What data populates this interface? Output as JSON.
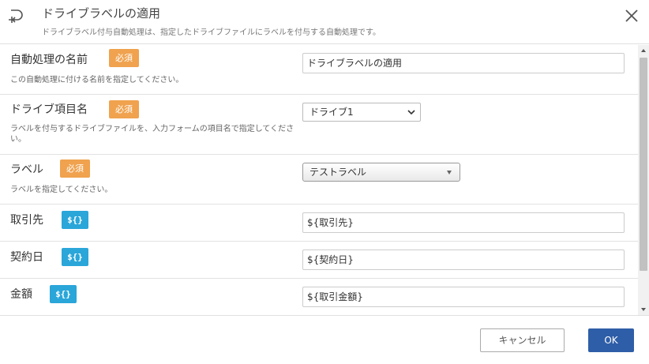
{
  "header": {
    "title": "ドライブラベルの適用",
    "subtitle": "ドライブラベル付与自動処理は、指定したドライブファイルにラベルを付与する自動処理です。",
    "icon": "add-process-icon"
  },
  "badges": {
    "required": "必須",
    "variable": "${}"
  },
  "fields": [
    {
      "label": "自動処理の名前",
      "required": true,
      "description": "この自動処理に付ける名前を指定してください。",
      "value": "ドライブラベルの適用"
    },
    {
      "label": "ドライブ項目名",
      "required": true,
      "description": "ラベルを付与するドライブファイルを、入力フォームの項目名で指定してください。",
      "selected": "ドライブ1"
    },
    {
      "label": "ラベル",
      "required": true,
      "description": "ラベルを指定してください。",
      "selected": "テストラベル"
    },
    {
      "label": "取引先",
      "variable": true,
      "value": "${取引先}"
    },
    {
      "label": "契約日",
      "variable": true,
      "value": "${契約日}"
    },
    {
      "label": "金額",
      "variable": true,
      "value": "${取引金額}"
    }
  ],
  "footer": {
    "cancel_label": "キャンセル",
    "ok_label": "OK"
  },
  "colors": {
    "required_badge": "#f0a24e",
    "variable_badge": "#2aa6d9",
    "ok_button": "#2f5ea8"
  }
}
